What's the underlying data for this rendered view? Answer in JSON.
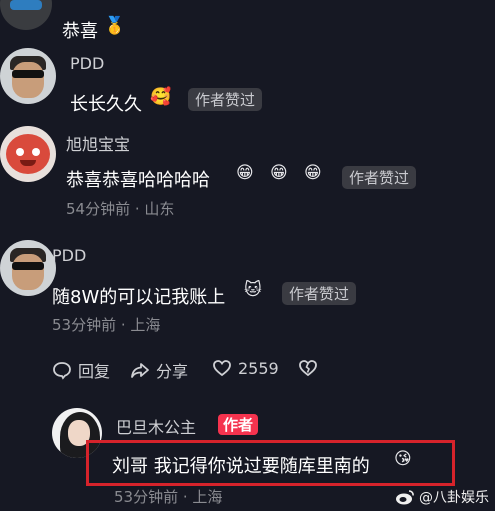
{
  "comments": [
    {
      "id": "c0",
      "text": "恭喜",
      "emoji": "🥇"
    },
    {
      "id": "c1",
      "author": "PDD",
      "text": "长长久久",
      "emoji": "🥰",
      "tag": "作者赞过"
    },
    {
      "id": "c2",
      "author": "旭旭宝宝",
      "text": "恭喜恭喜哈哈哈哈",
      "emojis": [
        "😁",
        "😁",
        "😁"
      ],
      "tag": "作者赞过",
      "meta": "54分钟前 · 山东"
    },
    {
      "id": "c3",
      "author": "PDD",
      "text": "随8W的可以记我账上",
      "emoji": "🐱",
      "tag": "作者赞过",
      "meta": "53分钟前 · 上海"
    },
    {
      "id": "c4",
      "author": "巴旦木公主",
      "author_badge": "作者",
      "text": "刘哥 我记得你说过要随库里南的",
      "emoji": "😘",
      "meta": "53分钟前 · 上海"
    }
  ],
  "actions": {
    "reply_label": "回复",
    "share_label": "分享",
    "like_count": "2559"
  },
  "watermark": "@八卦娱乐",
  "colors": {
    "background": "#161823",
    "author_badge": "#f5334e",
    "highlight_box": "#d6232b"
  }
}
